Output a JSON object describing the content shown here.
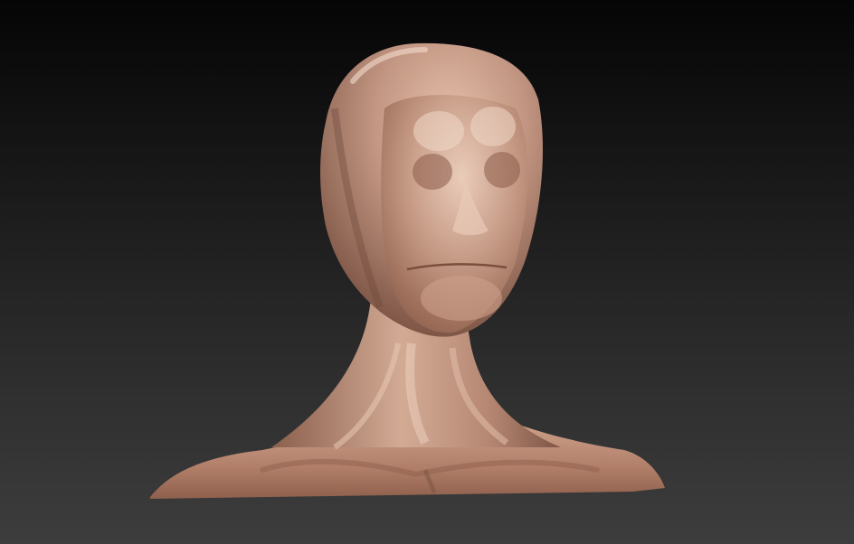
{
  "viewport": {
    "background_top": "#050505",
    "background_bottom": "#3d3d3d"
  },
  "model": {
    "subject": "sculpted-bust",
    "material_color": "#b98b74",
    "highlight_color": "#e7c3ae",
    "shadow_color": "#6f4a3a"
  }
}
